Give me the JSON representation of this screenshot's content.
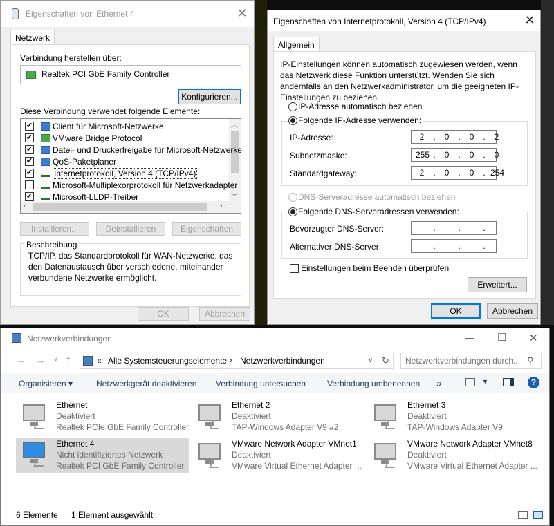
{
  "eth_props": {
    "title": "Eigenschaften von Ethernet 4",
    "tab": "Netzwerk",
    "connect_using_label": "Verbindung herstellen über:",
    "adapter_name": "Realtek PCI GbE Family Controller",
    "configure_btn": "Konfigurieren...",
    "items_label": "Diese Verbindung verwendet folgende Elemente:",
    "items": [
      {
        "label": "Client für Microsoft-Netzwerke",
        "checked": "✔"
      },
      {
        "label": "VMware Bridge Protocol",
        "checked": "✔"
      },
      {
        "label": "Datei- und Druckerfreigabe für Microsoft-Netzwerke",
        "checked": "✔"
      },
      {
        "label": "QoS-Paketplaner",
        "checked": "✔"
      },
      {
        "label": "Internetprotokoll, Version 4 (TCP/IPv4)",
        "checked": "✔"
      },
      {
        "label": "Microsoft-Multiplexorprotokoll für Netzwerkadapter",
        "checked": ""
      },
      {
        "label": "Microsoft-LLDP-Treiber",
        "checked": "✔"
      }
    ],
    "install_btn": "Installieren...",
    "uninstall_btn": "Deinstallieren",
    "properties_btn": "Eigenschaften",
    "description_label": "Beschreibung",
    "description_text": "TCP/IP, das Standardprotokoll für WAN-Netzwerke, das den Datenaustausch über verschiedene, miteinander verbundene Netzwerke ermöglicht.",
    "ok_btn": "OK",
    "cancel_btn": "Abbrechen"
  },
  "ipv4": {
    "title": "Eigenschaften von Internetprotokoll, Version 4 (TCP/IPv4)",
    "tab": "Allgemein",
    "intro": "IP-Einstellungen können automatisch zugewiesen werden, wenn das Netzwerk diese Funktion unterstützt. Wenden Sie sich andernfalls an den Netzwerkadministrator, um die geeigneten IP-Einstellungen zu beziehen.",
    "auto_ip": "IP-Adresse automatisch beziehen",
    "manual_ip": "Folgende IP-Adresse verwenden:",
    "ip_label": "IP-Adresse:",
    "ip": [
      "2",
      "0",
      "0",
      "2"
    ],
    "mask_label": "Subnetzmaske:",
    "mask": [
      "255",
      "0",
      "0",
      "0"
    ],
    "gw_label": "Standardgateway:",
    "gw": [
      "2",
      "0",
      "0",
      "254"
    ],
    "auto_dns": "DNS-Serveradresse automatisch beziehen",
    "manual_dns": "Folgende DNS-Serveradressen verwenden:",
    "dns1_label": "Bevorzugter DNS-Server:",
    "dns2_label": "Alternativer DNS-Server:",
    "dot": ".",
    "validate": "Einstellungen beim Beenden überprüfen",
    "advanced_btn": "Erweitert...",
    "ok_btn": "OK",
    "cancel_btn": "Abbrechen"
  },
  "explorer": {
    "title": "Netzwerkverbindungen",
    "minimize": "—",
    "maximize": "☐",
    "close": "✕",
    "breadcrumb_sep": "«",
    "crumb1": "Alle Systemsteuerungselemente",
    "crumb_arrow": "›",
    "crumb2": "Netzwerkverbindungen",
    "search_placeholder": "Netzwerkverbindungen durch...",
    "cmd_organize": "Organisieren ▾",
    "cmd_disable": "Netzwerkgerät deaktivieren",
    "cmd_diagnose": "Verbindung untersuchen",
    "cmd_rename": "Verbindung umbenennen",
    "cmd_more": "»",
    "adapters": [
      {
        "name": "Ethernet",
        "status": "Deaktiviert",
        "device": "Realtek PCIe GbE Family Controller"
      },
      {
        "name": "Ethernet 2",
        "status": "Deaktiviert",
        "device": "TAP-Windows Adapter V9 #2"
      },
      {
        "name": "Ethernet 3",
        "status": "Deaktiviert",
        "device": "TAP-Windows Adapter V9"
      },
      {
        "name": "Ethernet 4",
        "status": "Nicht identifiziertes Netzwerk",
        "device": "Realtek PCI GbE Family Controller"
      },
      {
        "name": "VMware Network Adapter VMnet1",
        "status": "Deaktiviert",
        "device": "VMware Virtual Ethernet Adapter ..."
      },
      {
        "name": "VMware Network Adapter VMnet8",
        "status": "Deaktiviert",
        "device": "VMware Virtual Ethernet Adapter ..."
      }
    ],
    "status_count": "6 Elemente",
    "status_selected": "1 Element ausgewählt"
  }
}
